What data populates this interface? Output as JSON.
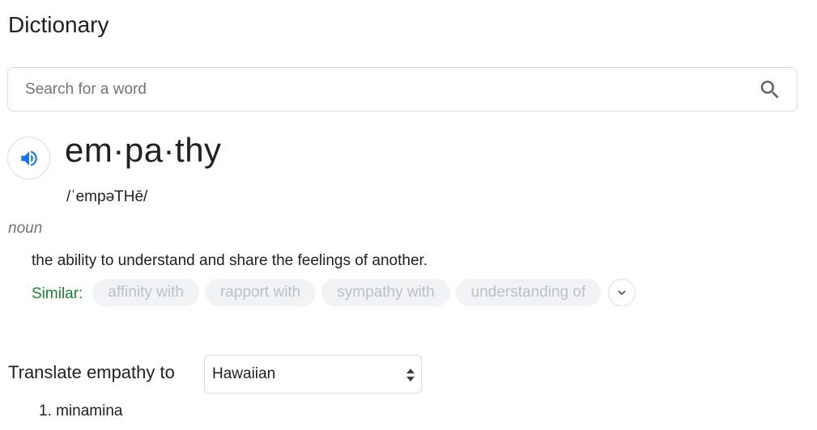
{
  "header": {
    "title": "Dictionary"
  },
  "search": {
    "placeholder": "Search for a word",
    "value": "",
    "icon": "search-icon"
  },
  "entry": {
    "speaker_icon": "speaker-icon",
    "headword": "em·pa·thy",
    "phonetic": "/ˈempəTHē/",
    "part_of_speech": "noun",
    "definition": "the ability to understand and share the feelings of another.",
    "similar_label": "Similar:",
    "similar": [
      "affinity with",
      "rapport with",
      "sympathy with",
      "understanding of"
    ],
    "expand_icon": "chevron-down-icon"
  },
  "translate": {
    "label": "Translate empathy to",
    "language": "Hawaiian",
    "results": [
      "1. minamina"
    ]
  },
  "colors": {
    "speaker_blue": "#1a73e8",
    "similar_green": "#188038",
    "chip_bg": "#f1f3f4",
    "chip_text": "#bdc1c6",
    "border": "#dadce0"
  }
}
